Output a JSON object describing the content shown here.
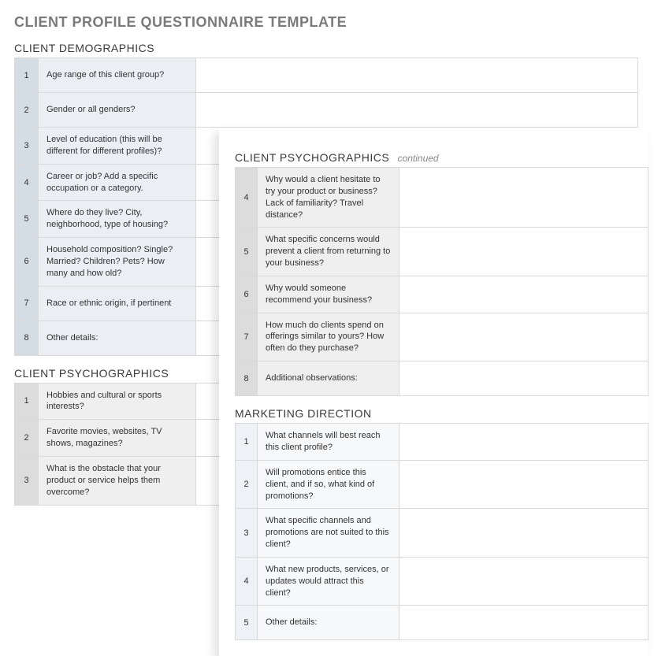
{
  "doc_title": "CLIENT PROFILE QUESTIONNAIRE TEMPLATE",
  "sections": {
    "demographics": {
      "title": "CLIENT DEMOGRAPHICS",
      "rows": [
        {
          "num": "1",
          "q": "Age range of this client group?",
          "a": ""
        },
        {
          "num": "2",
          "q": "Gender or all genders?",
          "a": ""
        },
        {
          "num": "3",
          "q": "Level of education (this will be different for different profiles)?",
          "a": ""
        },
        {
          "num": "4",
          "q": "Career or job? Add a specific occupation or a category.",
          "a": ""
        },
        {
          "num": "5",
          "q": "Where do they live? City, neighborhood, type of housing?",
          "a": ""
        },
        {
          "num": "6",
          "q": "Household composition? Single? Married? Children? Pets? How many and how old?",
          "a": ""
        },
        {
          "num": "7",
          "q": "Race or ethnic origin, if pertinent",
          "a": ""
        },
        {
          "num": "8",
          "q": "Other details:",
          "a": ""
        }
      ]
    },
    "psychographics": {
      "title": "CLIENT PSYCHOGRAPHICS",
      "rows": [
        {
          "num": "1",
          "q": "Hobbies and cultural or sports interests?",
          "a": ""
        },
        {
          "num": "2",
          "q": "Favorite movies, websites, TV shows, magazines?",
          "a": ""
        },
        {
          "num": "3",
          "q": "What is the obstacle that your product or service helps them overcome?",
          "a": ""
        }
      ]
    },
    "psychographics_cont": {
      "title": "CLIENT PSYCHOGRAPHICS",
      "continued": "continued",
      "rows": [
        {
          "num": "4",
          "q": "Why would a client hesitate to try your product or business? Lack of familiarity? Travel distance?",
          "a": ""
        },
        {
          "num": "5",
          "q": "What specific concerns would prevent a client from returning to your business?",
          "a": ""
        },
        {
          "num": "6",
          "q": "Why would someone recommend your business?",
          "a": ""
        },
        {
          "num": "7",
          "q": "How much do clients spend on offerings similar to yours? How often do they purchase?",
          "a": ""
        },
        {
          "num": "8",
          "q": "Additional observations:",
          "a": ""
        }
      ]
    },
    "marketing": {
      "title": "MARKETING DIRECTION",
      "rows": [
        {
          "num": "1",
          "q": "What channels will best reach this client profile?",
          "a": ""
        },
        {
          "num": "2",
          "q": "Will promotions entice this client, and if so, what kind of promotions?",
          "a": ""
        },
        {
          "num": "3",
          "q": "What specific channels and promotions are not suited to this client?",
          "a": ""
        },
        {
          "num": "4",
          "q": "What new products, services, or updates would attract this client?",
          "a": ""
        },
        {
          "num": "5",
          "q": "Other details:",
          "a": ""
        }
      ]
    }
  }
}
